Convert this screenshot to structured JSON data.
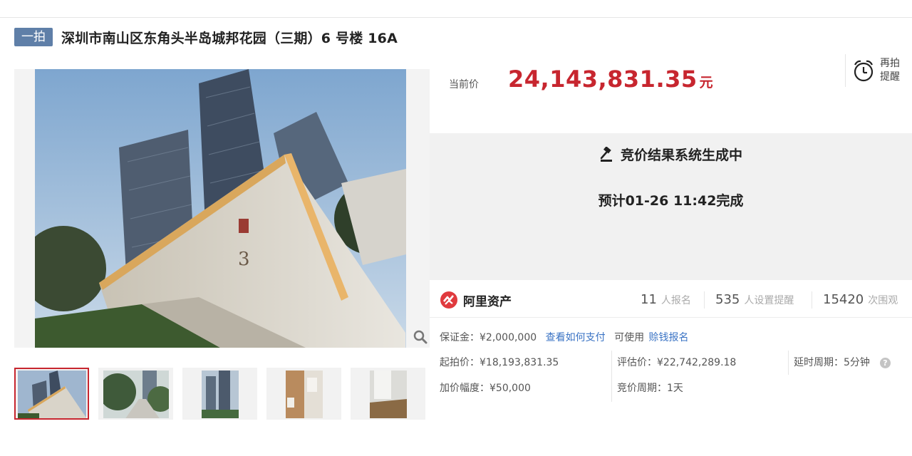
{
  "header": {
    "badge": "一拍",
    "title": "深圳市南山区东角头半岛城邦花园（三期）6 号楼 16A"
  },
  "gallery": {
    "main_alt": "building-photo",
    "zoom_icon": "magnifier-icon",
    "thumbnails": [
      {
        "name": "thumb-building-exterior",
        "active": true
      },
      {
        "name": "thumb-garden-path",
        "active": false
      },
      {
        "name": "thumb-towers",
        "active": false
      },
      {
        "name": "thumb-door",
        "active": false
      },
      {
        "name": "thumb-room",
        "active": false
      }
    ]
  },
  "price": {
    "label": "当前价",
    "value": "24,143,831.35",
    "unit": "元",
    "remind_line1": "再拍",
    "remind_line2": "提醒"
  },
  "status": {
    "line1": "竞价结果系统生成中",
    "line2": "预计01-26 11:42完成"
  },
  "stats": {
    "brand": "阿里资产",
    "signups": "11",
    "signups_label": "人报名",
    "reminders": "535",
    "reminders_label": "人设置提醒",
    "views": "15420",
    "views_label": "次围观"
  },
  "details": {
    "deposit": "保证金：¥2,000,000",
    "how_to_pay": "查看如何支付",
    "can_use": "可使用",
    "credit_signup": "赊钱报名",
    "start_price": "起拍价：¥18,193,831.35",
    "appraisal": "评估价：¥22,742,289.18",
    "delay": "延时周期：5分钟",
    "increment": "加价幅度：¥50,000",
    "cycle": "竞价周期：1天"
  },
  "colors": {
    "accent_red": "#c7262f",
    "badge_blue": "#5f7fa8",
    "link_blue": "#3a73c4"
  }
}
